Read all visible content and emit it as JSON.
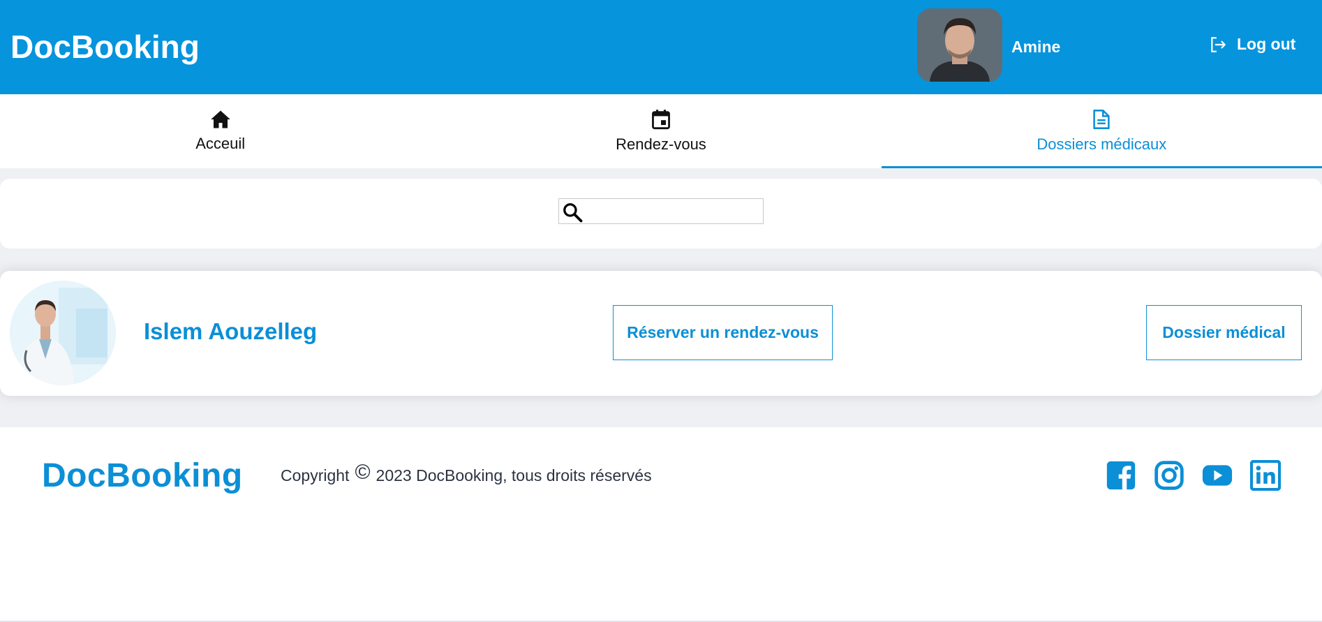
{
  "header": {
    "brand": "DocBooking",
    "user_name": "Amine",
    "logout_label": "Log out"
  },
  "nav": {
    "tabs": [
      {
        "label": "Acceuil",
        "icon": "home-icon",
        "active": false
      },
      {
        "label": "Rendez-vous",
        "icon": "calendar-icon",
        "active": false
      },
      {
        "label": "Dossiers médicaux",
        "icon": "document-icon",
        "active": true
      }
    ]
  },
  "search": {
    "value": "",
    "placeholder": ""
  },
  "doctor": {
    "name": "Islem Aouzelleg",
    "book_label": "Réserver un rendez-vous",
    "record_label": "Dossier médical"
  },
  "footer": {
    "brand": "DocBooking",
    "copyright_word": "Copyright",
    "copyright_symbol": "©",
    "copyright_text": "2023 DocBooking, tous droits réservés",
    "socials": [
      "facebook-icon",
      "instagram-icon",
      "youtube-icon",
      "linkedin-icon"
    ]
  },
  "colors": {
    "primary": "#0694dc",
    "accent": "#0b8fd6",
    "background": "#eef0f4"
  }
}
